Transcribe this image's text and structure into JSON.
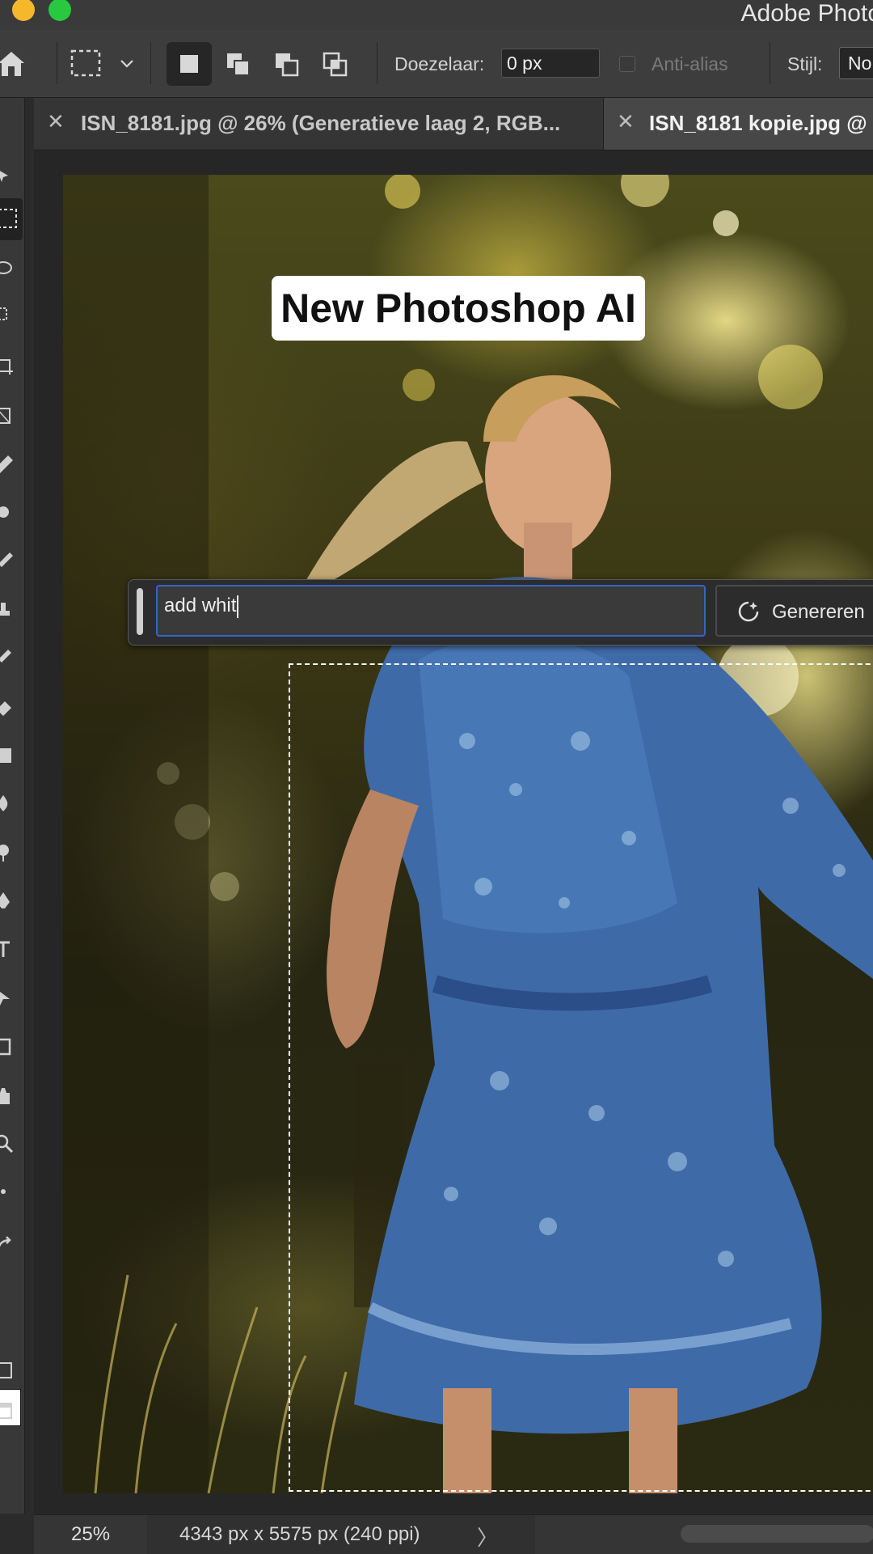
{
  "app": {
    "title": "Adobe Photo"
  },
  "options_bar": {
    "feather_label": "Doezelaar:",
    "feather_value": "0 px",
    "antialias_label": "Anti-alias",
    "style_label": "Stijl:",
    "style_value": "No"
  },
  "tabs": [
    {
      "label": "ISN_8181.jpg @ 26% (Generatieve laag 2, RGB...",
      "active": false
    },
    {
      "label": "ISN_8181 kopie.jpg @",
      "active": true
    }
  ],
  "canvas": {
    "overlay_text": "New Photoshop AI"
  },
  "generative_bar": {
    "prompt_value": "add whit",
    "generate_label": "Genereren"
  },
  "status": {
    "zoom": "25%",
    "doc_info": "4343 px x 5575 px (240 ppi)",
    "arrow": "〉"
  },
  "colors": {
    "focus_border": "#3464c8",
    "foreground_swatch": "#ffffff"
  }
}
